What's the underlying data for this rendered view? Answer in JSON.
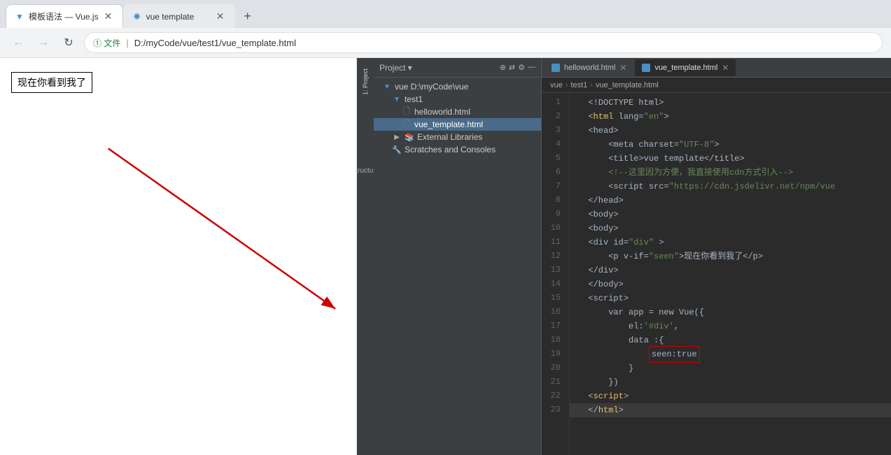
{
  "browser": {
    "tabs": [
      {
        "id": "tab1",
        "favicon": "▼",
        "favicon_color": "#4a90d9",
        "title": "模板语法 — Vue.js",
        "active": true,
        "closable": true
      },
      {
        "id": "tab2",
        "favicon": "◉",
        "favicon_color": "#4a8ec2",
        "title": "vue template",
        "active": false,
        "closable": true
      }
    ],
    "new_tab_label": "+",
    "nav": {
      "back_label": "←",
      "forward_label": "→",
      "reload_label": "↻"
    },
    "address": {
      "scheme": "① 文件",
      "path": "D:/myCode/vue/test1/vue_template.html"
    }
  },
  "browser_content": {
    "visible_text": "现在你看到我了",
    "box_border": "1px solid #000"
  },
  "ide": {
    "breadcrumb": {
      "vue": "vue",
      "sep1": "›",
      "test1": "test1",
      "sep2": "›",
      "file": "vue_template.html"
    },
    "project_header": {
      "title": "Project",
      "icons": [
        "⊕",
        "⇄",
        "⚙",
        "—"
      ]
    },
    "tree": [
      {
        "indent": 0,
        "icon": "▼",
        "icon_color": "#4a90d9",
        "label": "vue D:\\myCode\\vue",
        "selected": false
      },
      {
        "indent": 1,
        "icon": "▼",
        "icon_color": "#4a90d9",
        "label": "test1",
        "selected": false
      },
      {
        "indent": 2,
        "icon": "🗎",
        "icon_color": "#4a8ec2",
        "label": "helloworld.html",
        "selected": false
      },
      {
        "indent": 2,
        "icon": "🗎",
        "icon_color": "#4a8ec2",
        "label": "vue_template.html",
        "selected": true
      },
      {
        "indent": 1,
        "icon": "▶",
        "icon_color": "#aaa",
        "label": "External Libraries",
        "selected": false
      },
      {
        "indent": 1,
        "icon": "🔧",
        "icon_color": "#aaa",
        "label": "Scratches and Consoles",
        "selected": false
      }
    ],
    "editor_tabs": [
      {
        "id": "tab1",
        "label": "helloworld.html",
        "active": false
      },
      {
        "id": "tab2",
        "label": "vue_template.html",
        "active": true
      }
    ],
    "code_lines": [
      {
        "num": 1,
        "tokens": [
          {
            "t": "<!DOCTYPE html>",
            "c": "c-white"
          }
        ]
      },
      {
        "num": 2,
        "tokens": [
          {
            "t": "<",
            "c": "c-white"
          },
          {
            "t": "html",
            "c": "c-red"
          },
          {
            "t": " lang=",
            "c": "c-white"
          },
          {
            "t": "\"en\"",
            "c": "c-green"
          },
          {
            "t": ">",
            "c": "c-white"
          }
        ]
      },
      {
        "num": 3,
        "tokens": [
          {
            "t": "<head>",
            "c": "c-white"
          }
        ]
      },
      {
        "num": 4,
        "tokens": [
          {
            "t": "    <meta charset=",
            "c": "c-white"
          },
          {
            "t": "\"UTF-8\"",
            "c": "c-green"
          },
          {
            "t": ">",
            "c": "c-white"
          }
        ]
      },
      {
        "num": 5,
        "tokens": [
          {
            "t": "    <title>vue template</title>",
            "c": "c-white"
          }
        ]
      },
      {
        "num": 6,
        "tokens": [
          {
            "t": "    <!--这里因为方便，我直接使用cdn方式引入-->",
            "c": "c-green"
          }
        ]
      },
      {
        "num": 7,
        "tokens": [
          {
            "t": "    <script src=",
            "c": "c-white"
          },
          {
            "t": "\"https://cdn.jsdelivr.net/npm/vue",
            "c": "c-green"
          }
        ]
      },
      {
        "num": 8,
        "tokens": [
          {
            "t": "</head>",
            "c": "c-white"
          }
        ]
      },
      {
        "num": 9,
        "tokens": [
          {
            "t": "<body>",
            "c": "c-white"
          }
        ]
      },
      {
        "num": 10,
        "tokens": [
          {
            "t": "<body>",
            "c": "c-white"
          }
        ]
      },
      {
        "num": 11,
        "tokens": [
          {
            "t": "<div id=",
            "c": "c-white"
          },
          {
            "t": "\"div\"",
            "c": "c-green"
          },
          {
            "t": " >",
            "c": "c-white"
          }
        ]
      },
      {
        "num": 12,
        "tokens": [
          {
            "t": "    <p v-if=",
            "c": "c-white"
          },
          {
            "t": "\"seen\"",
            "c": "c-green"
          },
          {
            "t": ">现在你看到我了</p>",
            "c": "c-white"
          }
        ]
      },
      {
        "num": 13,
        "tokens": [
          {
            "t": "</div>",
            "c": "c-white"
          }
        ]
      },
      {
        "num": 14,
        "tokens": [
          {
            "t": "</body>",
            "c": "c-white"
          }
        ]
      },
      {
        "num": 15,
        "tokens": [
          {
            "t": "<script>",
            "c": "c-white"
          }
        ]
      },
      {
        "num": 16,
        "tokens": [
          {
            "t": "    var app = new Vue({",
            "c": "c-white"
          }
        ]
      },
      {
        "num": 17,
        "tokens": [
          {
            "t": "        el:",
            "c": "c-white"
          },
          {
            "t": "'#div'",
            "c": "c-green"
          },
          {
            "t": ",",
            "c": "c-white"
          }
        ]
      },
      {
        "num": 18,
        "tokens": [
          {
            "t": "        data :{",
            "c": "c-white"
          }
        ]
      },
      {
        "num": 19,
        "tokens": [
          {
            "t": "            ",
            "c": "c-white"
          },
          {
            "t": "seen:true",
            "c": "c-seen",
            "box": true
          }
        ]
      },
      {
        "num": 20,
        "tokens": [
          {
            "t": "        }",
            "c": "c-white"
          }
        ]
      },
      {
        "num": 21,
        "tokens": [
          {
            "t": "    })",
            "c": "c-white"
          }
        ]
      },
      {
        "num": 22,
        "tokens": [
          {
            "t": "<",
            "c": "c-white"
          },
          {
            "t": "script",
            "c": "c-red"
          },
          {
            "t": ">",
            "c": "c-white"
          }
        ]
      },
      {
        "num": 23,
        "tokens": [
          {
            "t": "</",
            "c": "c-white"
          },
          {
            "t": "html",
            "c": "c-red"
          },
          {
            "t": ">",
            "c": "c-white"
          }
        ]
      }
    ]
  }
}
